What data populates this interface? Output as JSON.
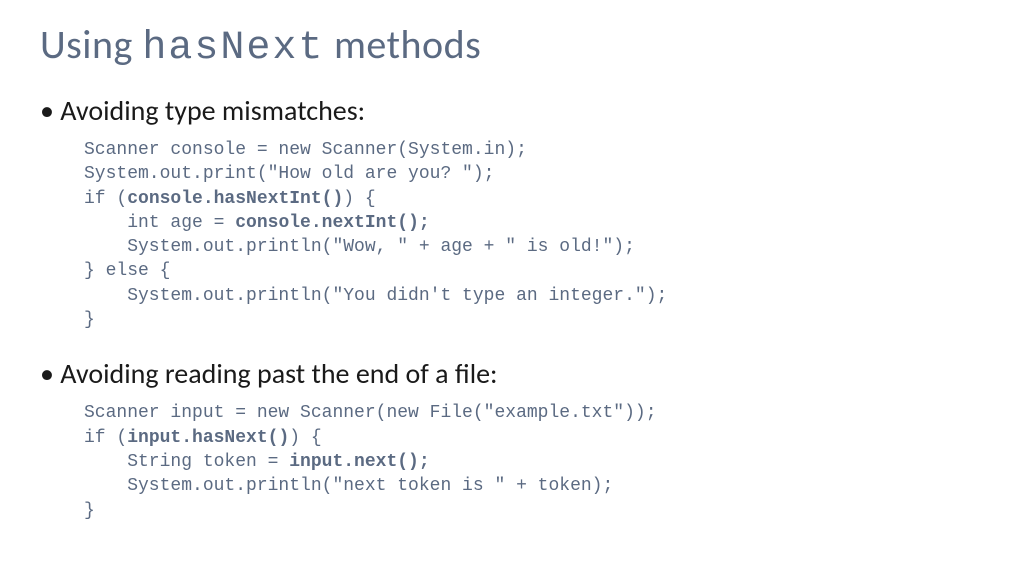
{
  "title": {
    "prefix": "Using ",
    "mono": "hasNext",
    "suffix": " methods"
  },
  "sections": [
    {
      "bullet": "Avoiding type mismatches:",
      "code_lines": [
        {
          "t": "Scanner console = new Scanner(System.in);"
        },
        {
          "t": "System.out.print(\"How old are you? \");"
        },
        {
          "t": "if (",
          "b": "console.hasNextInt()",
          "a": ") {"
        },
        {
          "t": "    int age = ",
          "b": "console.nextInt();",
          "a": ""
        },
        {
          "t": "    System.out.println(\"Wow, \" + age + \" is old!\");"
        },
        {
          "t": "} else {"
        },
        {
          "t": "    System.out.println(\"You didn't type an integer.\");"
        },
        {
          "t": "}"
        }
      ]
    },
    {
      "bullet": "Avoiding reading past the end of a file:",
      "code_lines": [
        {
          "t": "Scanner input = new Scanner(new File(\"example.txt\"));"
        },
        {
          "t": "if (",
          "b": "input.hasNext()",
          "a": ") {"
        },
        {
          "t": "    String token = ",
          "b": "input.next();",
          "a": ""
        },
        {
          "t": "    System.out.println(\"next token is \" + token);"
        },
        {
          "t": "}"
        }
      ]
    }
  ]
}
